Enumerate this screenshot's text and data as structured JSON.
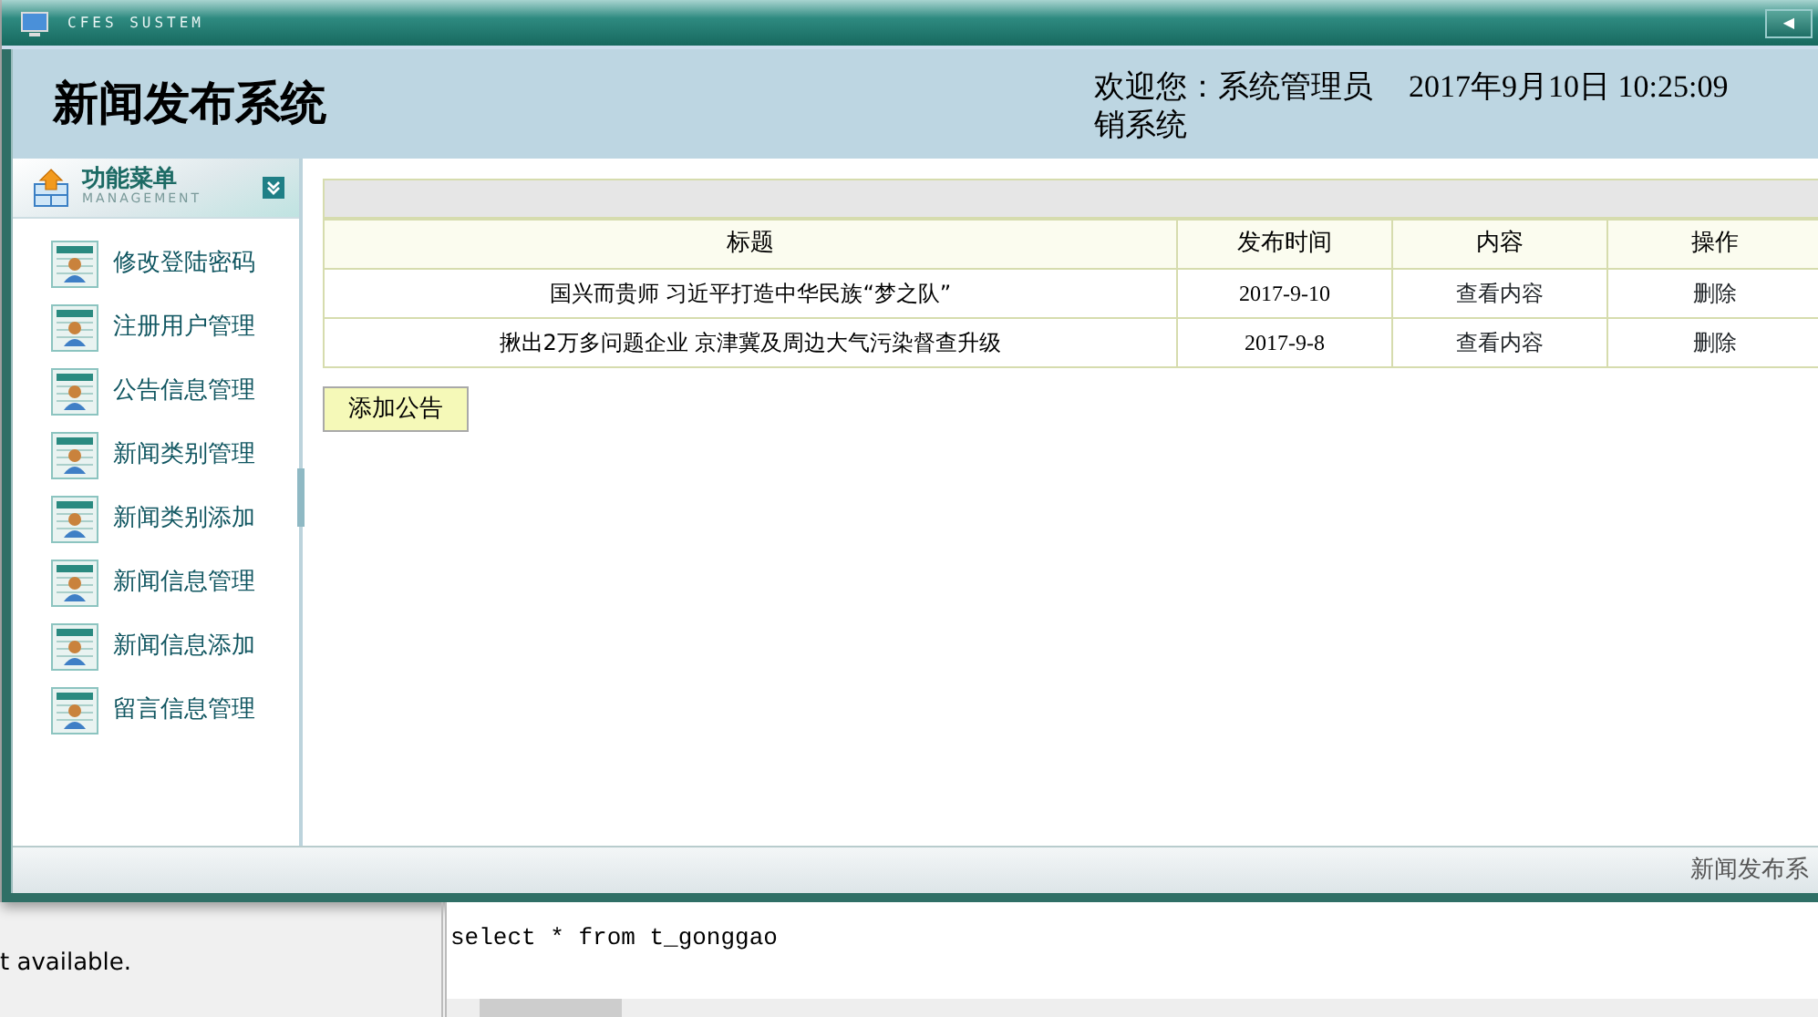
{
  "window": {
    "title": "CFES SUSTEM",
    "button": "◀"
  },
  "header": {
    "title": "新闻发布系统",
    "welcome": "欢迎您：系统管理员",
    "datetime": "2017年9月10日  10:25:09",
    "logout": "销系统"
  },
  "sidebar": {
    "title": "功能菜单",
    "subtitle": "MANAGEMENT",
    "items": [
      {
        "label": "修改登陆密码"
      },
      {
        "label": "注册用户管理"
      },
      {
        "label": "公告信息管理"
      },
      {
        "label": "新闻类别管理"
      },
      {
        "label": "新闻类别添加"
      },
      {
        "label": "新闻信息管理"
      },
      {
        "label": "新闻信息添加"
      },
      {
        "label": "留言信息管理"
      }
    ]
  },
  "table": {
    "columns": [
      "标题",
      "发布时间",
      "内容",
      "操作"
    ],
    "rows": [
      {
        "title": "国兴而贵师 习近平打造中华民族“梦之队”",
        "date": "2017-9-10",
        "view": "查看内容",
        "action": "删除"
      },
      {
        "title": "揪出2万多问题企业 京津冀及周边大气污染督查升级",
        "date": "2017-9-8",
        "view": "查看内容",
        "action": "删除"
      }
    ]
  },
  "add_button": "添加公告",
  "status_bar": "新闻发布系",
  "ide": {
    "console": "t available.",
    "editor_lines": [
      "select * from t_gonggao"
    ]
  }
}
